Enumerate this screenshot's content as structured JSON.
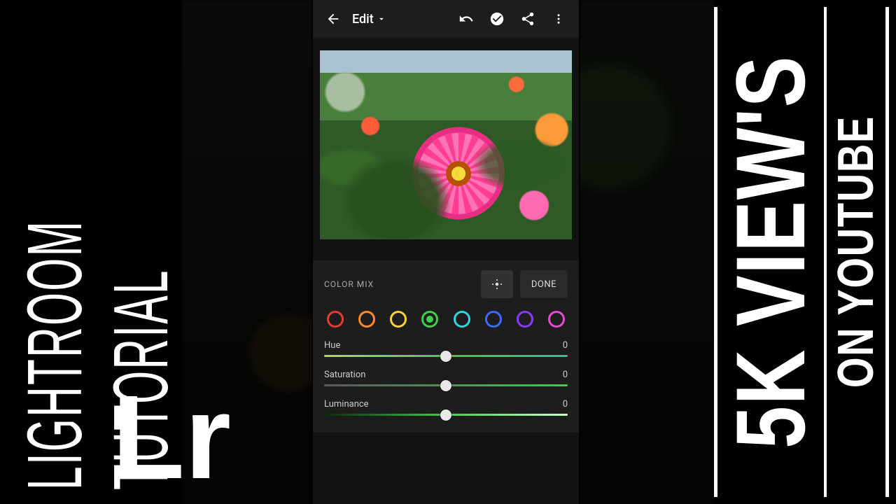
{
  "left": {
    "line1": "LIGHTROOM",
    "line2": "TUTORIAL",
    "logo": "Lr"
  },
  "right": {
    "line1": "5K VIEW'S",
    "line2": "ON YOUTUBE"
  },
  "appbar": {
    "title": "Edit",
    "icons": {
      "back": "back-arrow-icon",
      "dropdown": "caret-down-icon",
      "undo": "undo-icon",
      "check": "check-circle-icon",
      "share": "share-icon",
      "overflow": "overflow-menu-icon"
    }
  },
  "panel": {
    "title": "COLOR MIX",
    "picker_icon": "target-picker-icon",
    "done_label": "DONE",
    "swatches": [
      {
        "name": "red",
        "color": "#e63b2e",
        "active": false
      },
      {
        "name": "orange",
        "color": "#ff8a2a",
        "active": false
      },
      {
        "name": "yellow",
        "color": "#ffd23a",
        "active": false
      },
      {
        "name": "green",
        "color": "#3bcf4a",
        "active": true
      },
      {
        "name": "aqua",
        "color": "#2fd8d8",
        "active": false
      },
      {
        "name": "blue",
        "color": "#3b6bff",
        "active": false
      },
      {
        "name": "purple",
        "color": "#8a3bff",
        "active": false
      },
      {
        "name": "magenta",
        "color": "#e64bd6",
        "active": false
      }
    ],
    "sliders": {
      "hue": {
        "label": "Hue",
        "value": "0"
      },
      "saturation": {
        "label": "Saturation",
        "value": "0"
      },
      "luminance": {
        "label": "Luminance",
        "value": "0"
      }
    }
  }
}
